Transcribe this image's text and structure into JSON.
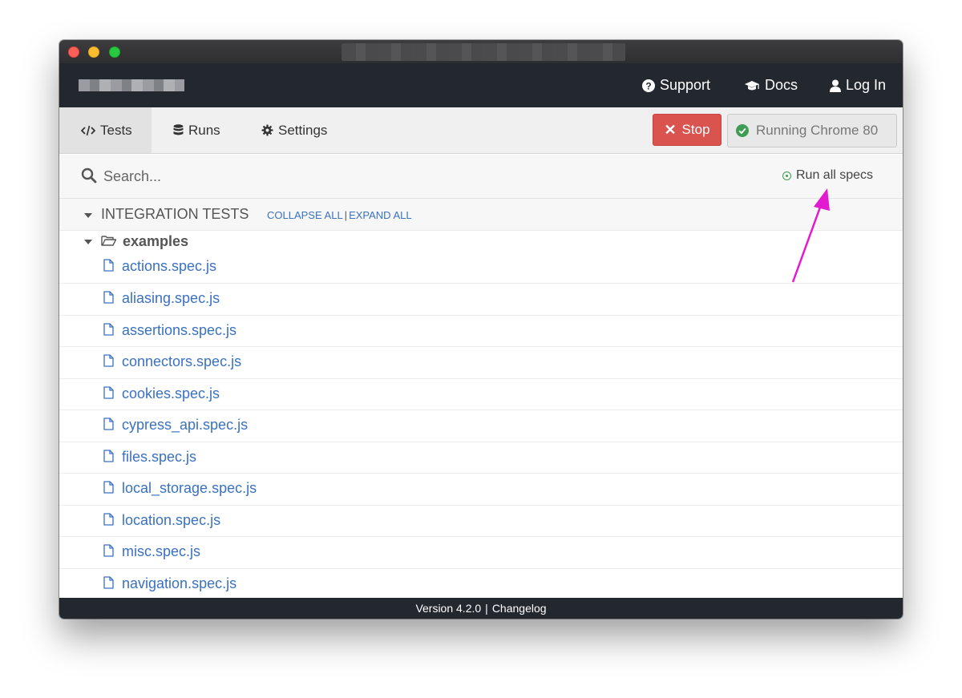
{
  "header": {
    "nav": [
      {
        "label": "Support",
        "icon": "question-circle-icon"
      },
      {
        "label": "Docs",
        "icon": "graduation-cap-icon"
      },
      {
        "label": "Log In",
        "icon": "user-icon"
      }
    ]
  },
  "tabs": [
    {
      "label": "Tests",
      "icon": "code-icon",
      "active": true
    },
    {
      "label": "Runs",
      "icon": "database-icon",
      "active": false
    },
    {
      "label": "Settings",
      "icon": "gear-icon",
      "active": false
    }
  ],
  "toolbar": {
    "stop_label": "Stop",
    "browser_label": "Running Chrome 80"
  },
  "search": {
    "placeholder": "Search...",
    "run_all_label": "Run all specs"
  },
  "specs": {
    "section_title": "INTEGRATION TESTS",
    "collapse_label": "COLLAPSE ALL",
    "separator": "|",
    "expand_label": "EXPAND ALL",
    "folder": "examples",
    "files": [
      "actions.spec.js",
      "aliasing.spec.js",
      "assertions.spec.js",
      "connectors.spec.js",
      "cookies.spec.js",
      "cypress_api.spec.js",
      "files.spec.js",
      "local_storage.spec.js",
      "location.spec.js",
      "misc.spec.js",
      "navigation.spec.js"
    ]
  },
  "footer": {
    "version": "Version 4.2.0",
    "separator": "|",
    "changelog": "Changelog"
  },
  "colors": {
    "header_bg": "#23272e",
    "link": "#3a71c1",
    "stop": "#d9534f",
    "success": "#3f9c54",
    "annotation_arrow": "#e21bd1"
  }
}
